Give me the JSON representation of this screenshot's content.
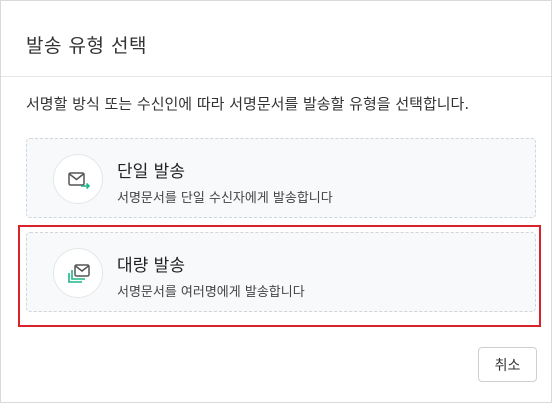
{
  "dialog": {
    "title": "발송 유형 선택",
    "description": "서명할 방식 또는 수신인에 따라 서명문서를 발송할 유형을 선택합니다.",
    "options": [
      {
        "title": "단일 발송",
        "subtitle": "서명문서를 단일 수신자에게 발송합니다",
        "icon": "envelope-send-icon"
      },
      {
        "title": "대량 발송",
        "subtitle": "서명문서를 여러명에게 발송합니다",
        "icon": "envelope-stack-icon",
        "highlighted": true
      }
    ],
    "cancel_label": "취소"
  },
  "colors": {
    "accent": "#1fb58a",
    "highlight_border": "#d9232a",
    "option_bg": "#f7f9fa"
  }
}
